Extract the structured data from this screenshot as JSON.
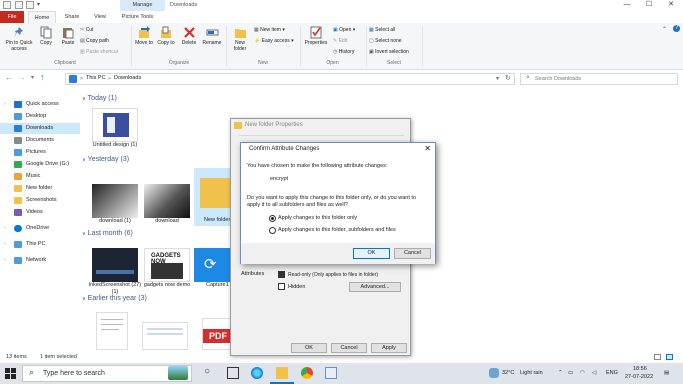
{
  "window": {
    "title": "Downloads",
    "context_tab": "Manage",
    "controls": {
      "minimize": "—",
      "maximize": "☐",
      "close": "✕"
    }
  },
  "ribbon_tabs": [
    "File",
    "Home",
    "Share",
    "View",
    "Picture Tools"
  ],
  "ribbon": {
    "clipboard": {
      "pin_label": "Pin to Quick access",
      "copy_label": "Copy",
      "paste_label": "Paste",
      "cut_label": "Cut",
      "copy_path_label": "Copy path",
      "paste_shortcut_label": "Paste shortcut",
      "group_label": "Clipboard"
    },
    "organize": {
      "move_to_label": "Move to",
      "copy_to_label": "Copy to",
      "delete_label": "Delete",
      "rename_label": "Rename",
      "group_label": "Organize"
    },
    "new": {
      "new_folder_label": "New folder",
      "new_item_label": "New item",
      "easy_access_label": "Easy access",
      "group_label": "New"
    },
    "open": {
      "properties_label": "Properties",
      "open_label": "Open",
      "edit_label": "Edit",
      "history_label": "History",
      "group_label": "Open"
    },
    "select": {
      "select_all_label": "Select all",
      "select_none_label": "Select none",
      "invert_label": "Invert selection",
      "group_label": "Select"
    }
  },
  "address": {
    "crumbs": [
      "This PC",
      "Downloads"
    ],
    "separator": ">",
    "search_placeholder": "Search Downloads"
  },
  "nav": {
    "items": [
      {
        "label": "Quick access",
        "icon": "star-icon",
        "color": "#1e6fd0"
      },
      {
        "label": "Desktop",
        "icon": "desktop-icon",
        "color": "#4a9be0"
      },
      {
        "label": "Downloads",
        "icon": "download-icon",
        "color": "#2a7fd4"
      },
      {
        "label": "Documents",
        "icon": "document-icon",
        "color": "#8a8a8a"
      },
      {
        "label": "Pictures",
        "icon": "pictures-icon",
        "color": "#4a9be0"
      },
      {
        "label": "Google Drive (G:)",
        "icon": "drive-icon",
        "color": "#34a853"
      },
      {
        "label": "Music",
        "icon": "music-icon",
        "color": "#e8a33a"
      },
      {
        "label": "New folder",
        "icon": "folder-icon",
        "color": "#f0c24b"
      },
      {
        "label": "Screenshots",
        "icon": "folder-icon",
        "color": "#f0c24b"
      },
      {
        "label": "Videos",
        "icon": "video-icon",
        "color": "#7a58c4"
      },
      {
        "label": "OneDrive",
        "icon": "cloud-icon",
        "color": "#0078d7"
      },
      {
        "label": "This PC",
        "icon": "computer-icon",
        "color": "#4a9be0"
      },
      {
        "label": "Network",
        "icon": "network-icon",
        "color": "#4a9be0"
      }
    ]
  },
  "groups": {
    "today": "Today (1)",
    "yesterday": "Yesterday (3)",
    "last_month": "Last month (6)",
    "earlier": "Earlier this year (3)"
  },
  "files": {
    "today": [
      {
        "name": "Untitled design (1)"
      }
    ],
    "yesterday": [
      {
        "name": "download (1)"
      },
      {
        "name": "download"
      },
      {
        "name": "New folder"
      }
    ],
    "last_month": [
      {
        "name": "lnkedScreenshot (27) (1)"
      },
      {
        "name": "gadgets now demo",
        "thumb_text": "GADGETS NOW"
      },
      {
        "name": "Capture1"
      }
    ],
    "earlier": [
      {
        "name": ""
      },
      {
        "name": ""
      },
      {
        "name": "",
        "thumb_text": "PDF"
      }
    ]
  },
  "status": {
    "items_count": "13 items",
    "selected": "1 item selected"
  },
  "properties_dialog": {
    "title": "New folder Properties",
    "attributes_label": "Attributes",
    "readonly_label": "Read-only (Only applies to files in folder)",
    "hidden_label": "Hidden",
    "advanced_label": "Advanced...",
    "ok_label": "OK",
    "cancel_label": "Cancel",
    "apply_label": "Apply"
  },
  "confirm_dialog": {
    "title": "Confirm Attribute Changes",
    "close": "✕",
    "intro": "You have chosen to make the following attribute changes:",
    "change": "encrypt",
    "question_line1": "Do you want to apply this change to this folder only, or do you want to",
    "question_line2": "apply it to all subfolders and files as well?",
    "option1": "Apply changes to this folder only",
    "option2": "Apply changes to this folder, subfolders and files",
    "ok_label": "OK",
    "cancel_label": "Cancel"
  },
  "taskbar": {
    "search_placeholder": "Type here to search",
    "temperature": "32°C",
    "weather": "Light rain",
    "language": "ENG",
    "time": "18:56",
    "date": "27-07-2022"
  },
  "colors": {
    "file_tab": "#c42b1c",
    "selection": "#cce8ff",
    "accent": "#0078d7"
  }
}
